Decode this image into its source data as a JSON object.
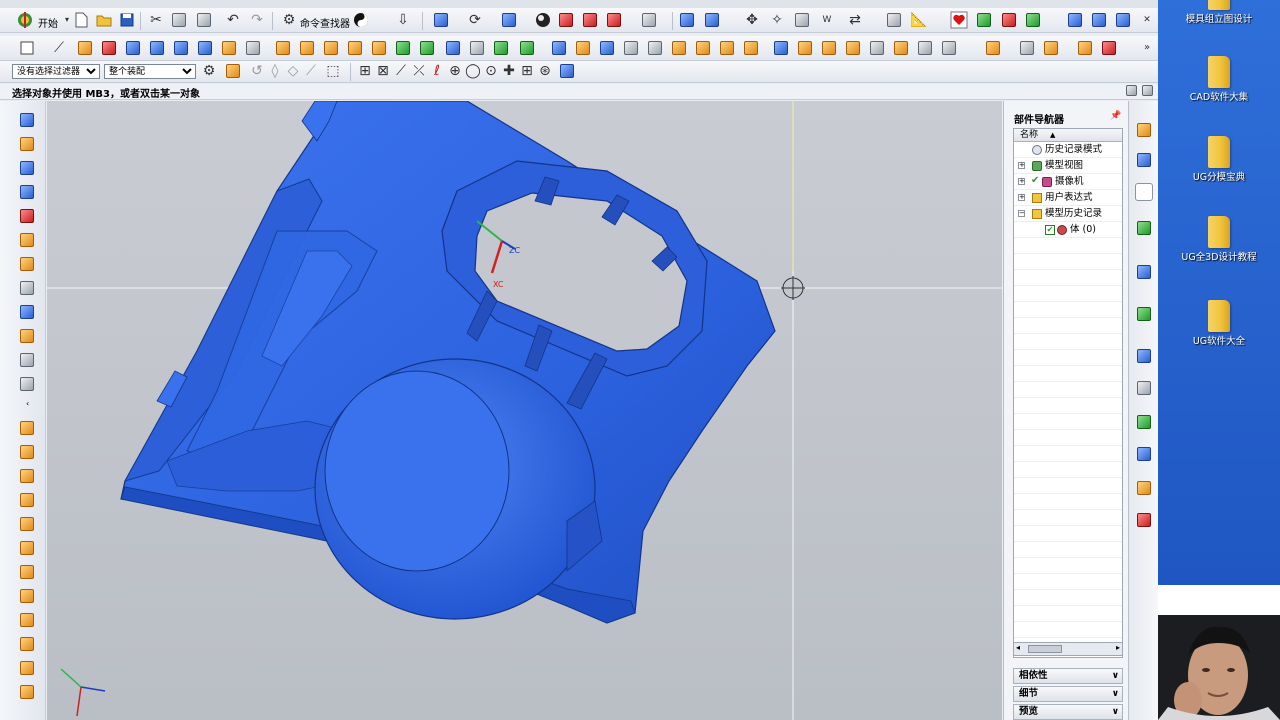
{
  "toolbar": {
    "start_label": "开始",
    "command_finder_label": "命令查找器"
  },
  "filters": {
    "type_filter": "没有选择过滤器",
    "assembly_filter": "整个装配"
  },
  "status": {
    "message": "选择对象并使用 MB3，或者双击某一对象"
  },
  "viewport": {
    "axis_labels": {
      "zc": "ZC",
      "xc": "XC"
    },
    "model_color": "#2f64e0",
    "background_color": "#c4c7cd"
  },
  "navigator": {
    "title": "部件导航器",
    "column_header": "名称",
    "tree": [
      {
        "label": "历史记录模式",
        "level": 0,
        "icon": "clock-icon"
      },
      {
        "label": "模型视图",
        "level": 0,
        "icon": "model-view-icon",
        "expander": "+"
      },
      {
        "label": "摄像机",
        "level": 0,
        "icon": "camera-icon",
        "expander": "+",
        "checked": true
      },
      {
        "label": "用户表达式",
        "level": 0,
        "icon": "folder-icon",
        "expander": "+"
      },
      {
        "label": "模型历史记录",
        "level": 0,
        "icon": "folder-icon",
        "expander": "-"
      },
      {
        "label": "体 (0)",
        "level": 1,
        "icon": "body-icon",
        "checked": true
      }
    ],
    "panels": [
      {
        "label": "相依性"
      },
      {
        "label": "细节"
      },
      {
        "label": "预览"
      }
    ]
  },
  "desktop": {
    "icons": [
      {
        "label": "模具组立图设计"
      },
      {
        "label": "CAD软件大集"
      },
      {
        "label": "UG分模宝典"
      },
      {
        "label": "UG全3D设计教程"
      },
      {
        "label": "UG软件大全"
      }
    ]
  },
  "colors": {
    "accent": "#2f64e0",
    "desktop": "#2b6bd6"
  }
}
